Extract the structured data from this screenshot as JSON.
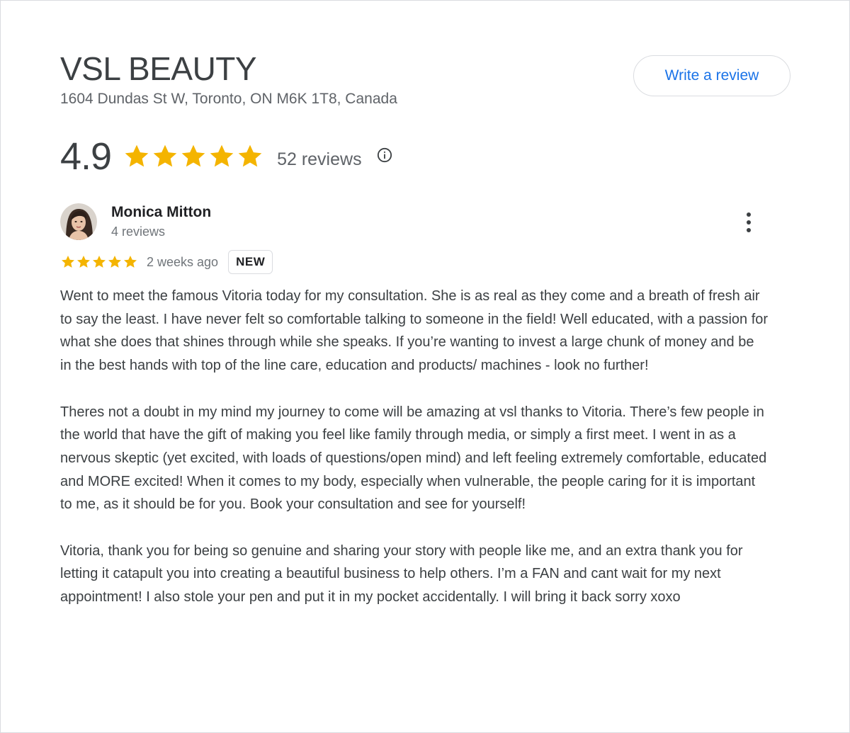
{
  "business": {
    "name": "VSL BEAUTY",
    "address": "1604 Dundas St W, Toronto, ON M6K 1T8, Canada",
    "rating": "4.9",
    "stars": 5,
    "review_count": "52 reviews",
    "write_review_label": "Write a review"
  },
  "review": {
    "author": "Monica Mitton",
    "author_meta": "4 reviews",
    "stars": 5,
    "date": "2 weeks ago",
    "badge": "NEW",
    "paragraphs": [
      "Went to meet the famous Vitoria today for my consultation. She is as real as they come and a breath of fresh air to say the least. I have never felt so comfortable talking to someone in the field! Well educated, with a passion for what she does that shines through while she speaks. If you’re wanting to invest a large chunk of money and be in the best hands with top of the line care, education and products/ machines - look no further!",
      "Theres not a doubt in my mind my journey to come will be amazing at vsl thanks to Vitoria. There’s few people in the world that have the gift of making you feel like family through media, or simply a first meet. I went in as a nervous skeptic (yet excited, with loads of questions/open mind) and left feeling extremely comfortable, educated and MORE excited! When it comes to my body, especially when vulnerable, the people caring for it is important to me, as it should be for you. Book your consultation and see for yourself!",
      "Vitoria, thank you for being so genuine and sharing your story with people like me, and an extra thank you for letting it catapult you into creating a beautiful business to help others. I’m a FAN and cant wait for my next appointment! I also stole your pen and put it in my pocket accidentally. I will bring it back sorry xoxo"
    ]
  },
  "colors": {
    "star": "#f4b400",
    "link": "#1a73e8",
    "muted": "#70757a"
  },
  "icons": {
    "info": "info-circle-icon",
    "more": "more-vert-icon",
    "star": "star-icon"
  }
}
